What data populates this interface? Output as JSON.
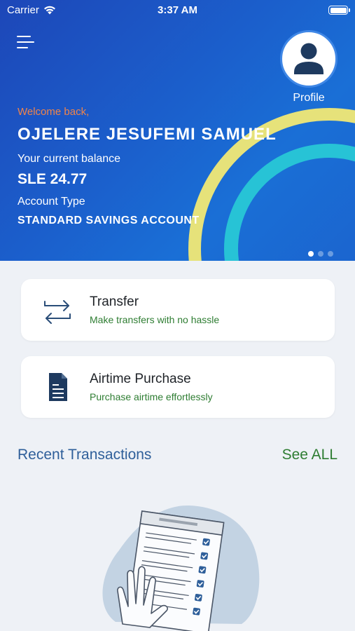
{
  "status_bar": {
    "carrier": "Carrier",
    "time": "3:37 AM"
  },
  "header": {
    "profile_label": "Profile",
    "welcome": "Welcome back,",
    "name": "OJELERE JESUFEMI SAMUEL",
    "balance_label": "Your current balance",
    "balance": "SLE 24.77",
    "account_type_label": "Account Type",
    "account_type": "STANDARD SAVINGS ACCOUNT",
    "carousel_pages": 3,
    "carousel_active": 1
  },
  "actions": [
    {
      "title": "Transfer",
      "subtitle": "Make transfers with no hassle",
      "icon": "transfer-arrows-icon"
    },
    {
      "title": "Airtime Purchase",
      "subtitle": "Purchase airtime effortlessly",
      "icon": "document-icon"
    }
  ],
  "recent": {
    "title": "Recent Transactions",
    "see_all": "See ALL"
  },
  "colors": {
    "hero_blue": "#1d47b8",
    "welcome_orange": "#f0844a",
    "green": "#2e7d32",
    "heading_blue": "#2f5f9a",
    "ring_yellow": "#e6e27a",
    "ring_cyan": "#27c3d6",
    "background": "#eef1f6"
  }
}
